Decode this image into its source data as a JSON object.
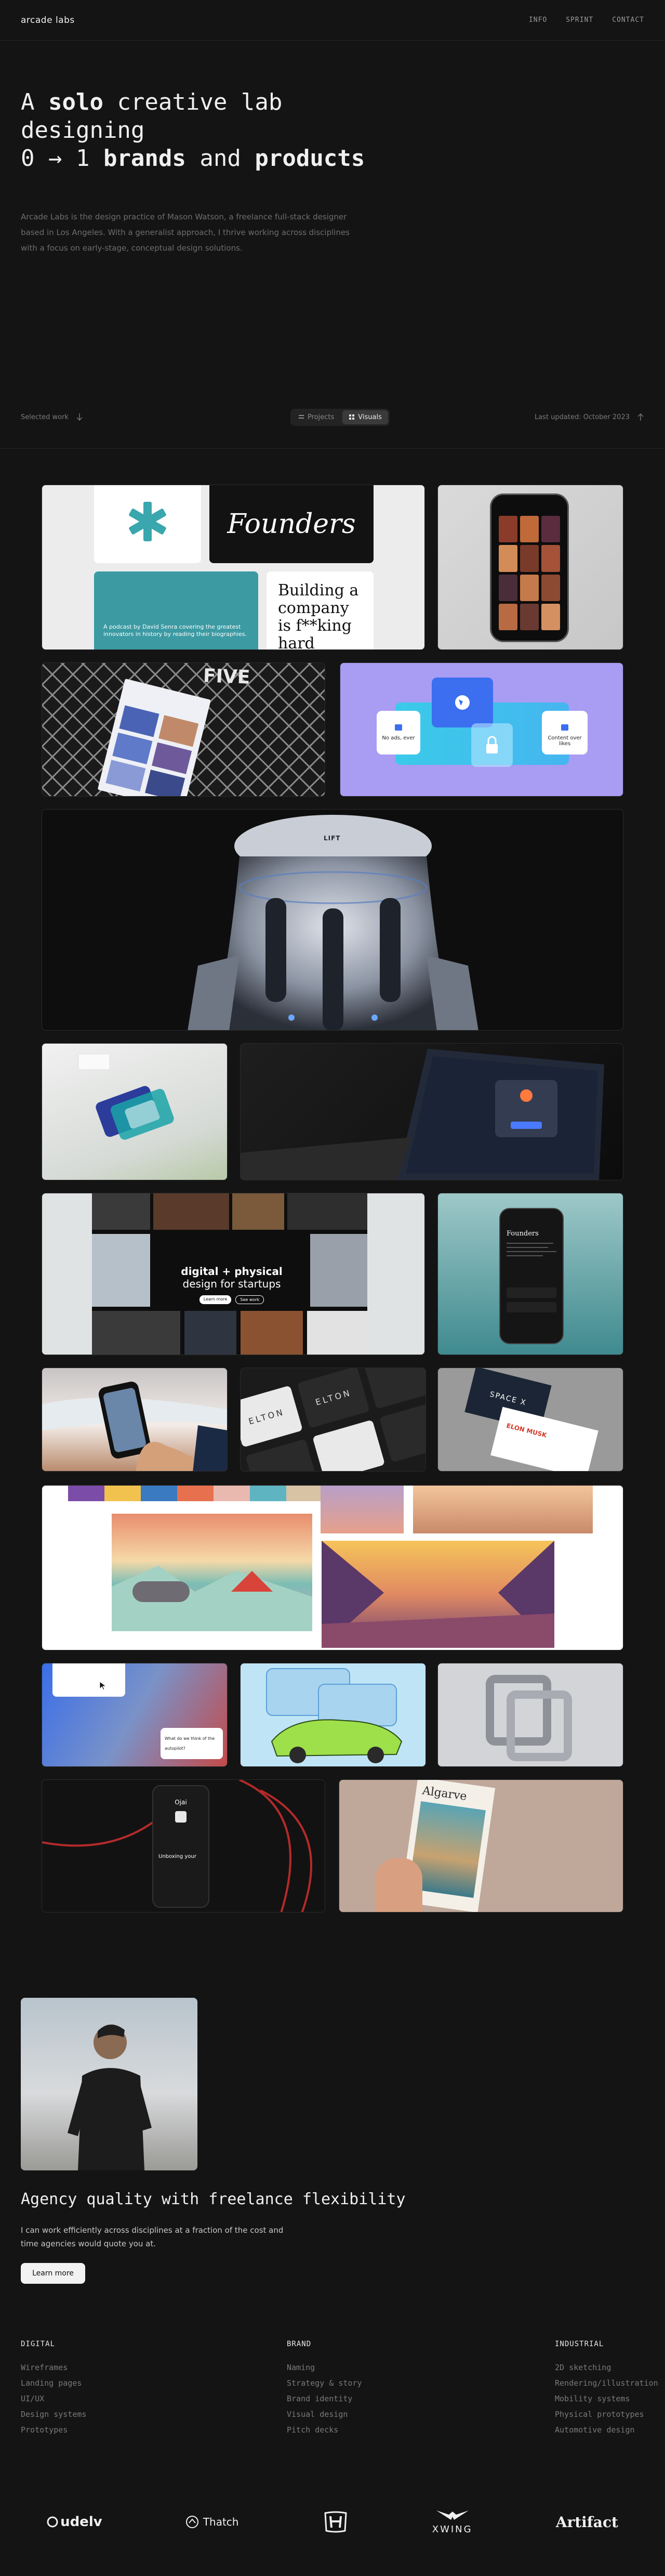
{
  "header": {
    "logo": "arcade labs",
    "nav": [
      "INFO",
      "SPRINT",
      "CONTACT"
    ]
  },
  "hero": {
    "line1_pre": "A ",
    "line1_bold": "solo",
    "line1_post": " creative lab designing",
    "line2_pre": "0 → 1 ",
    "line2_bold1": "brands",
    "line2_mid": " and ",
    "line2_bold2": "products",
    "description": "Arcade Labs is the design practice of Mason Watson, a freelance full-stack designer based in Los Angeles. With a generalist approach, I thrive working across disciplines with a focus on early-stage, conceptual design solutions."
  },
  "bar": {
    "selected_work": "Selected work",
    "toggle_projects": "Projects",
    "toggle_visuals": "Visuals",
    "updated": "Last updated: October 2023"
  },
  "gallery": {
    "founders_title": "Founders",
    "podcast_text": "A podcast by David Senra covering the greatest innovators in history by reading their biographies.",
    "book_line1": "Building a",
    "book_line2": "company",
    "book_line3": "is f**king",
    "book_line4": "hard",
    "five_title": "FIVE",
    "chip_left": "No ads, ever",
    "chip_right": "Content over likes",
    "lift_label": "LIFT",
    "digital_line1": "digital + physical",
    "digital_line2": "design for startups",
    "digital_btn1": "Learn more",
    "digital_btn2": "See work",
    "founders_app_title": "Founders",
    "elton_key": "ELTON",
    "spacex_text": "SPACE X",
    "elon_name": "ELON MUSK",
    "mobility_note": "What do we think of the autopilot?",
    "ojai_title": "Ojai",
    "unboxing_text": "Unboxing your",
    "algarve_title": "Algarve"
  },
  "about": {
    "title": "Agency quality with freelance flexibility",
    "text": "I can work efficiently across disciplines at a fraction of the cost and time agencies would quote you at.",
    "button": "Learn more"
  },
  "services": [
    {
      "heading": "DIGITAL",
      "items": [
        "Wireframes",
        "Landing pages",
        "UI/UX",
        "Design systems",
        "Prototypes"
      ]
    },
    {
      "heading": "BRAND",
      "items": [
        "Naming",
        "Strategy & story",
        "Brand identity",
        "Visual design",
        "Pitch decks"
      ]
    },
    {
      "heading": "INDUSTRIAL",
      "items": [
        "2D sketching",
        "Rendering/illustration",
        "Mobility systems",
        "Physical prototypes",
        "Automotive design"
      ]
    }
  ],
  "clients": {
    "udelv": "udelv",
    "thatch": "Thatch",
    "xwing": "XWING",
    "artifact": "Artifact"
  },
  "colors": {
    "background": "#141414",
    "accent_purple": "#a99cf3",
    "teal": "#44a3ad",
    "white": "#f2f2f2"
  }
}
